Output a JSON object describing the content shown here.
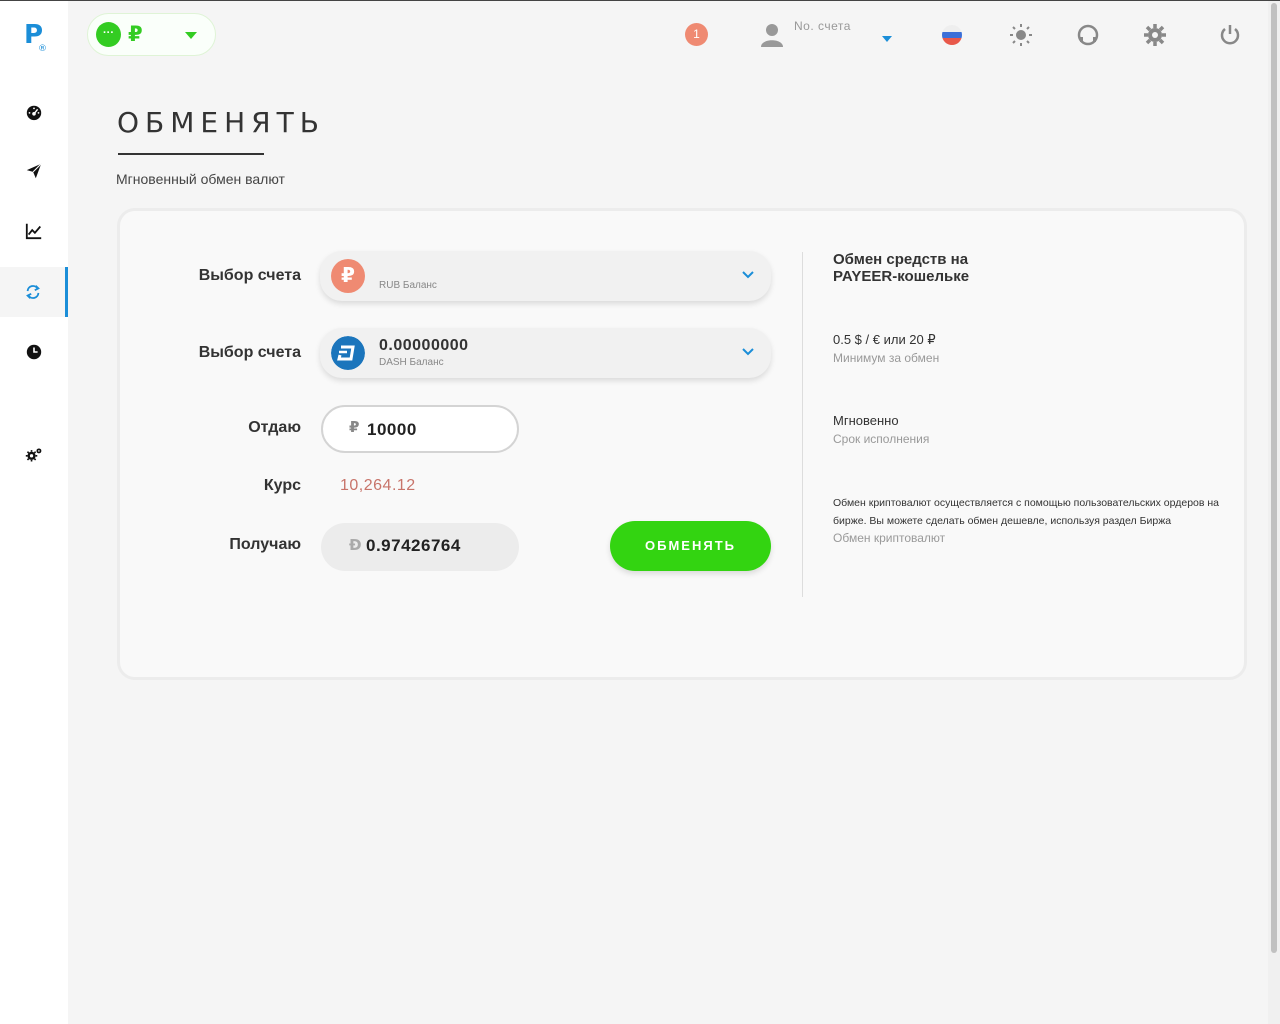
{
  "header": {
    "currency_symbol": "₽",
    "currency_dot": "···",
    "notification_count": "1",
    "account_label": "No. счета"
  },
  "page": {
    "title": "ОБМЕНЯТЬ",
    "subtitle": "Мгновенный обмен валют"
  },
  "form": {
    "from_label": "Выбор счета",
    "from_amount": "",
    "from_balance": "RUB Баланс",
    "from_coin": "₽",
    "to_label": "Выбор счета",
    "to_amount": "0.00000000",
    "to_balance": "DASH Баланс",
    "give_label": "Отдаю",
    "give_symbol": "₽",
    "give_value": "10000",
    "rate_label": "Курс",
    "rate_value": "10,264.12",
    "get_label": "Получаю",
    "get_symbol": "Đ",
    "get_value": "0.97426764",
    "submit_label": "ОБМЕНЯТЬ"
  },
  "info": {
    "title": "Обмен средств на PAYEER-кошельке",
    "min_value": "0.5 $ / € или 20 ₽",
    "min_label": "Минимум за обмен",
    "time_value": "Мгновенно",
    "time_label": "Срок исполнения",
    "note": "Обмен криптовалют осуществляется с помощью пользовательских ордеров на бирже. Вы можете сделать обмен дешевле, используя раздел Биржа",
    "link": "Обмен криптовалют"
  },
  "colors": {
    "accent_blue": "#1b8ed8",
    "green": "#33d411",
    "rub_coin": "#ef8a72",
    "dash_coin": "#1b75bc",
    "rate": "#c8746a"
  }
}
